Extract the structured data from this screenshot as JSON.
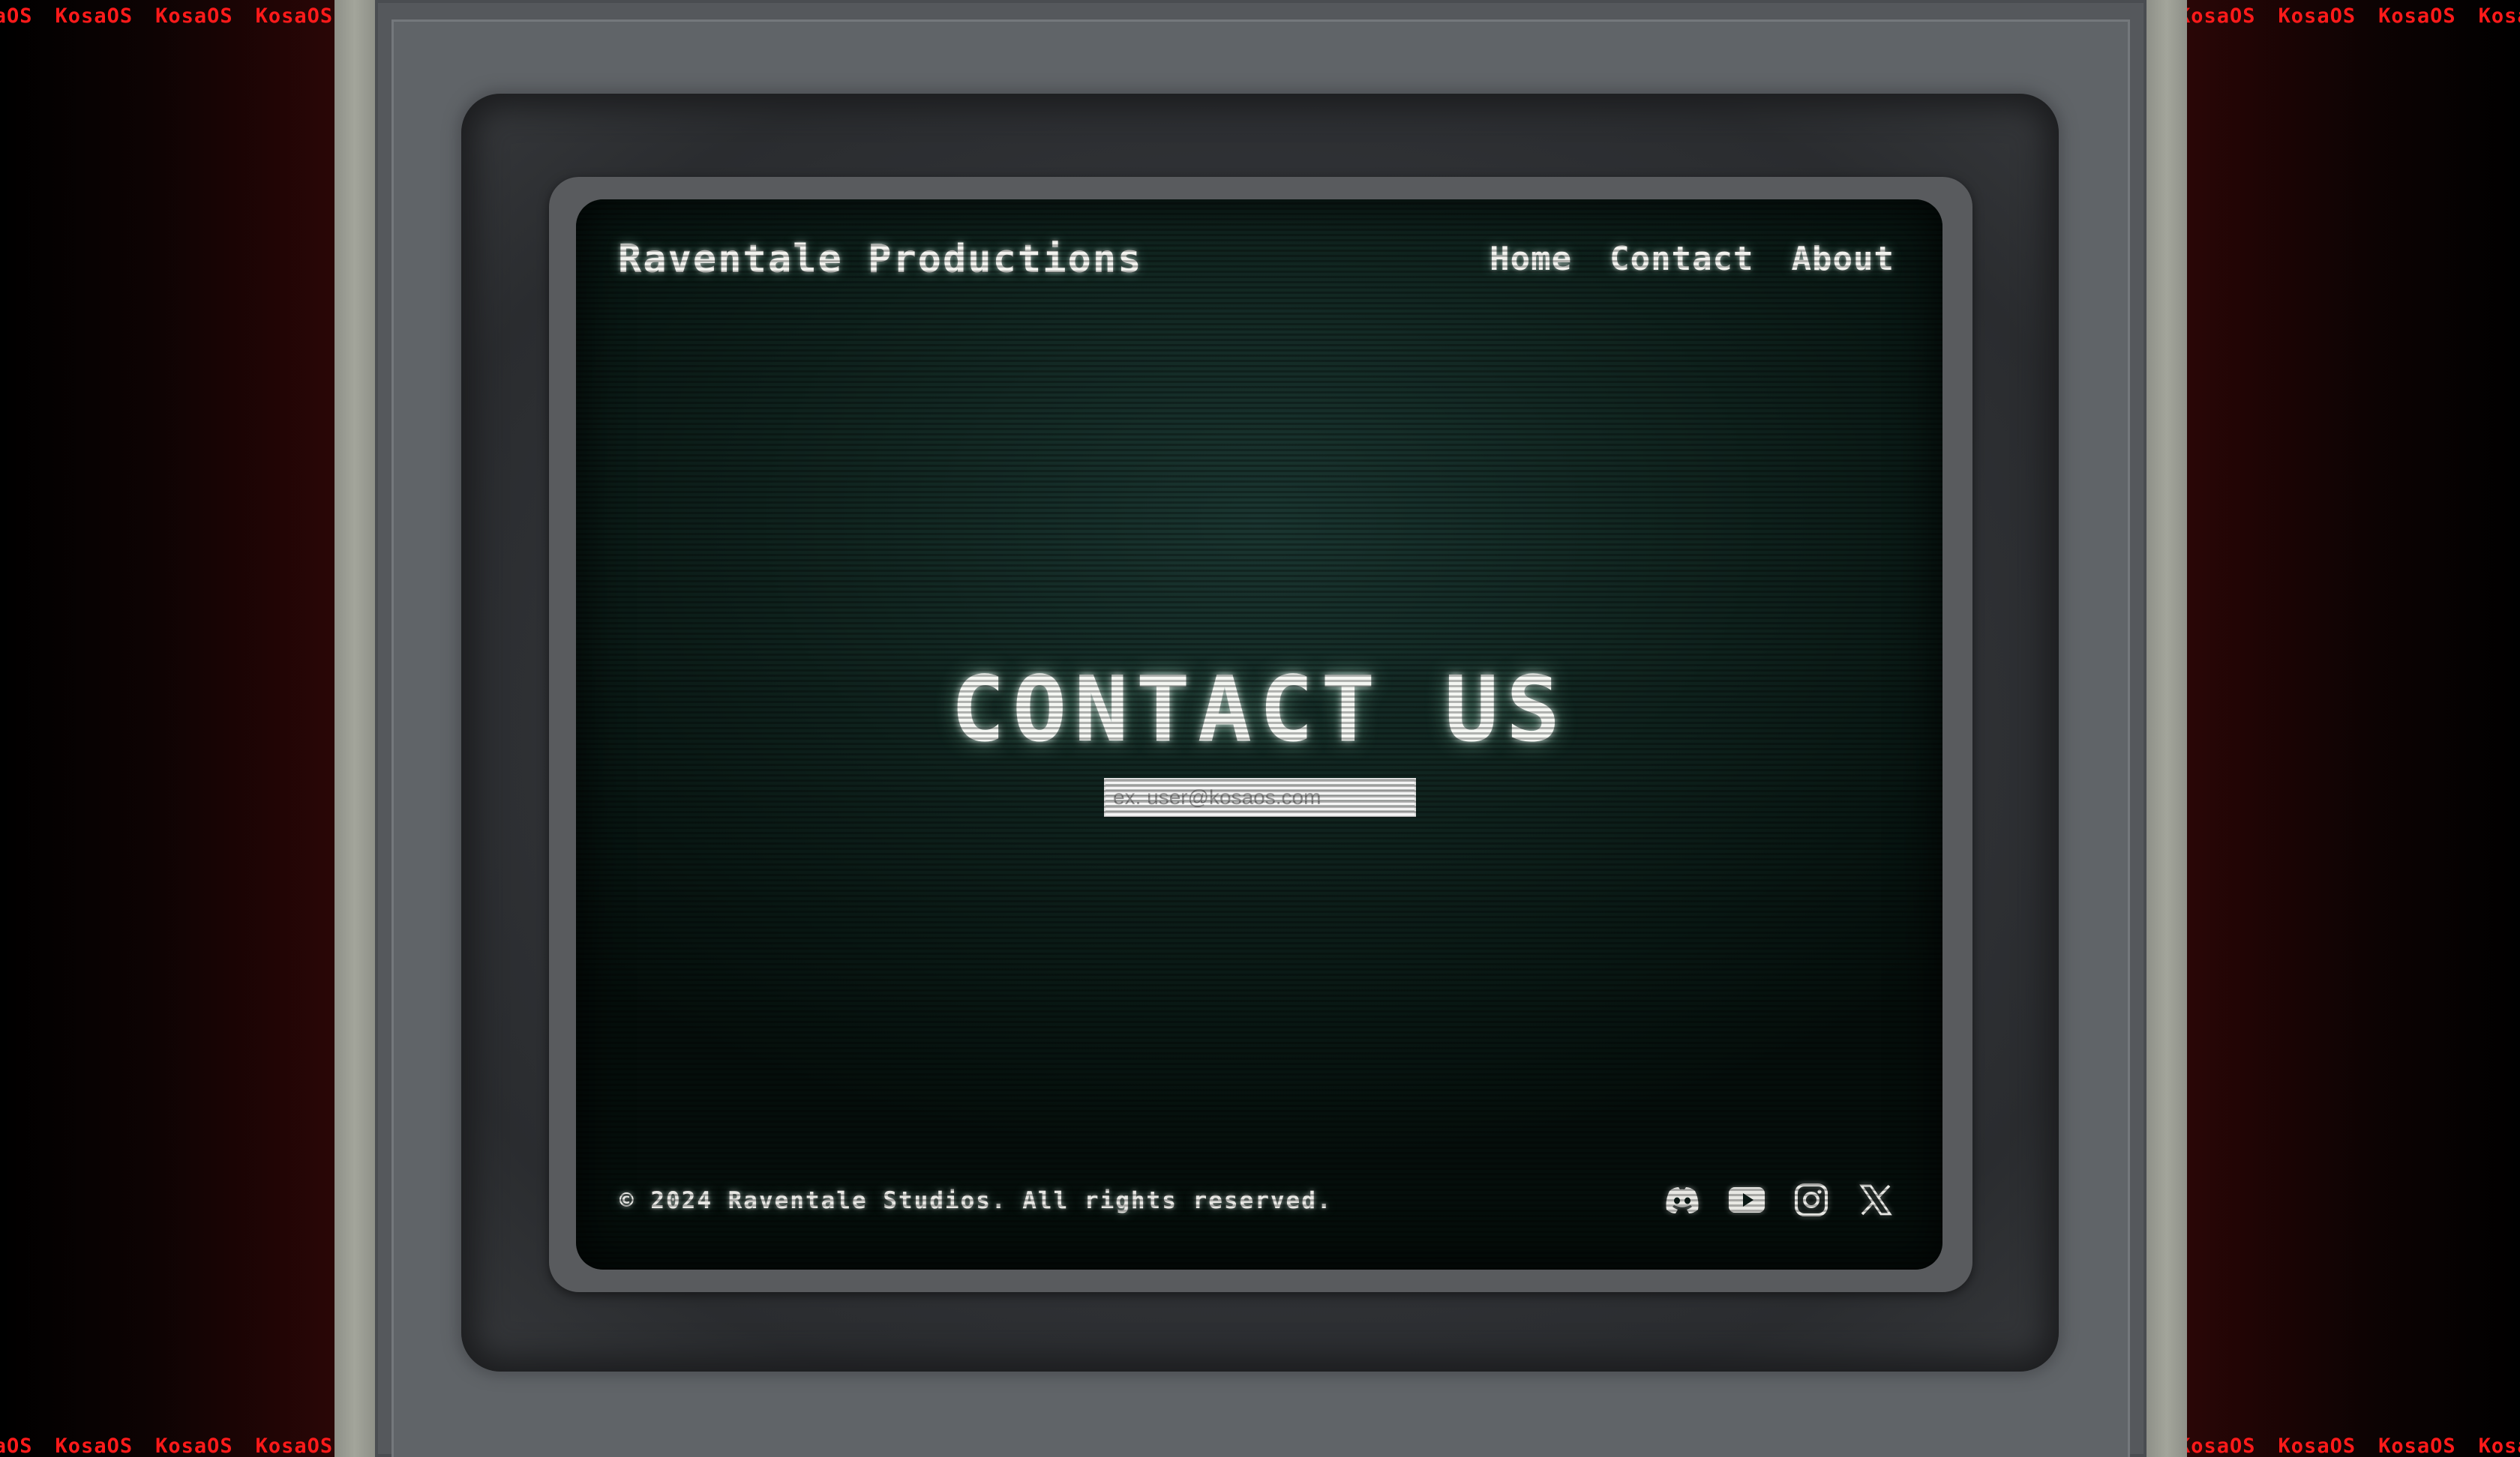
{
  "marquee": {
    "word": "KosaOS",
    "repeat": 8
  },
  "site": {
    "brand": "Raventale Productions",
    "nav": [
      {
        "label": "Home"
      },
      {
        "label": "Contact"
      },
      {
        "label": "About"
      }
    ]
  },
  "main": {
    "headline": "CONTACT US",
    "email_placeholder": "ex. user@kosaos.com",
    "email_value": ""
  },
  "footer": {
    "copyright": "© 2024 Raventale Studios. All rights reserved.",
    "socials": [
      {
        "icon": "discord-icon"
      },
      {
        "icon": "youtube-icon"
      },
      {
        "icon": "instagram-icon"
      },
      {
        "icon": "x-icon"
      }
    ]
  },
  "colors": {
    "marquee": "#ff1a1a",
    "screen_bg": "#10241f",
    "text": "#f2f2ee"
  }
}
